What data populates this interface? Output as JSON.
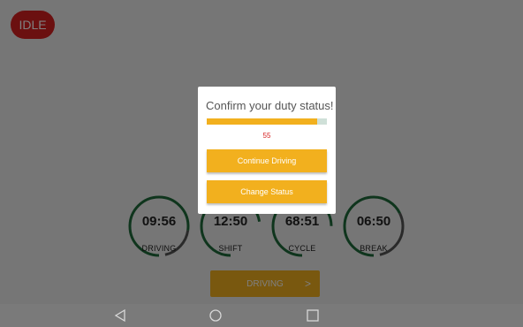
{
  "status_badge": "IDLE",
  "gauges": [
    {
      "time": "09:56",
      "label": "DRIVING"
    },
    {
      "time": "12:50",
      "label": "SHIFT"
    },
    {
      "time": "68:51",
      "label": "CYCLE"
    },
    {
      "time": "06:50",
      "label": "BREAK"
    }
  ],
  "status_button": {
    "label": "DRIVING",
    "arrow": ">"
  },
  "dialog": {
    "title": "Confirm your duty status!",
    "progress_fraction": 0.92,
    "countdown": "55",
    "continue_label": "Continue Driving",
    "change_label": "Change Status"
  },
  "colors": {
    "accent": "#f2b01e",
    "danger": "#d62020",
    "gauge_ring": "#1f6b3a"
  },
  "nav_icons": [
    "back-icon",
    "home-icon",
    "recents-icon"
  ]
}
